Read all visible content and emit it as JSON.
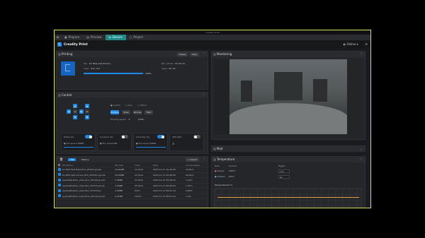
{
  "window": {
    "title": "Creality Print"
  },
  "tabs": [
    {
      "label": "Prepare"
    },
    {
      "label": "Preview"
    },
    {
      "label": "Device"
    },
    {
      "label": "Project"
    }
  ],
  "app": {
    "name": "Creality Print",
    "status": "Online"
  },
  "printing": {
    "title": "Printing",
    "btn_pause": "Pause",
    "btn_stop": "Stop",
    "file_label": "File",
    "file_value": "K1 MAX_test.Frame...",
    "time_label": "Time",
    "time_value": "0:0 / 0:0",
    "left_label": "Est. remain",
    "left_value": "0h 0m 0s",
    "layer_label": "Layer",
    "layer_value": "0m 0s",
    "progress": "100%",
    "progress_value": 1.0
  },
  "monitoring": {
    "title": "Monitoring"
  },
  "control": {
    "title": "Control",
    "mode_labels": [
      "0.1mm",
      "1mm",
      "10mm"
    ],
    "fan_labels": [
      "0.1x",
      "1x",
      "10x"
    ],
    "speed_buttons": [
      "Printing",
      "Slow",
      "Normal",
      "Fast"
    ],
    "speed_label": "Printing speed",
    "speed_value": "3",
    "speed_pct": "100%",
    "cards": [
      {
        "label": "Model fan",
        "sub": "Fan speed",
        "val": "100%",
        "on": true
      },
      {
        "label": "Auxiliary fan",
        "sub": "Fan speed",
        "val": "0%",
        "on": false
      },
      {
        "label": "Chamber fan",
        "sub": "Fan speed",
        "val": "100%",
        "on": true
      },
      {
        "label": "LED light",
        "sub": "",
        "val": "",
        "on": false
      }
    ]
  },
  "files": {
    "tab_file": "File",
    "tab_history": "History",
    "btn_import": "Import",
    "columns": [
      "File Name",
      "File Size",
      "Time",
      "Date",
      "Consumables"
    ],
    "rows": [
      {
        "name": "K1 MAX first Rald_PLA_1h52m.gcode",
        "size": "18.81MB",
        "time": "1h 9min",
        "date": "2023-11-17 10:16:45",
        "cons": "10.61m"
      },
      {
        "name": "K1 MAX test Curves_PLA_23h55m.gcode",
        "size": "39.09MB",
        "time": "2h 5min",
        "date": "2023-11-17 09:48:30",
        "cons": "26.61m"
      },
      {
        "name": "sys/Calibration_cube_PLA_15m39.gcode",
        "size": "5.48MB",
        "time": "0h 8min",
        "date": "2023-11-17 09:48:30",
        "cons": "1.22m"
      },
      {
        "name": "sys/Calibration_cube PLA_15m32.gcode",
        "size": "3.40MB",
        "time": "0h 5min",
        "date": "2023-11-17 09:48:30",
        "cons": "1.31m"
      },
      {
        "name": "sys/Calibration_cube PLA_15 Hollow...",
        "size": "4.99MB",
        "time": "3min",
        "date": "2023-11-17 09:47:14",
        "cons": "0.69m"
      },
      {
        "name": "sys/Calibration Cube_PLA_12m14.gcode",
        "size": "2.01MB",
        "time": "12min",
        "date": "2023-11-17 09:47:14",
        "cons": "1.4m"
      }
    ]
  },
  "model": {
    "title": "Mod"
  },
  "temperature": {
    "title": "Temperature",
    "col_item": "Item",
    "col_current": "Current",
    "col_target": "Target",
    "rows": [
      {
        "name": "Nozzle",
        "current": "230°C",
        "target": "230"
      },
      {
        "name": "Hotbed",
        "current": "54°C",
        "target": "60"
      }
    ],
    "graph_title": "Temperature(°C)"
  }
}
